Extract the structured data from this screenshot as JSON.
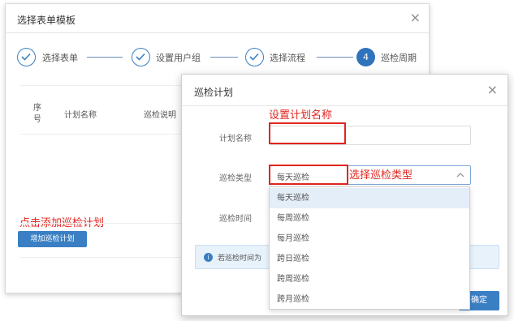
{
  "back_dialog": {
    "title": "选择表单模板",
    "close": "×",
    "steps": [
      {
        "label": "选择表单"
      },
      {
        "label": "设置用户组"
      },
      {
        "label": "选择流程"
      },
      {
        "number": "4",
        "label": "巡检周期"
      }
    ],
    "table_headers": {
      "seq": "序号",
      "name": "计划名称",
      "desc": "巡检说明"
    },
    "add_plan_button": "增加巡检计划"
  },
  "front_dialog": {
    "title": "巡检计划",
    "close": "×",
    "fields": {
      "name_label": "计划名称",
      "type_label": "巡检类型",
      "time_label": "巡检时间",
      "type_value": "每天巡检"
    },
    "info_text": "若巡检时间为",
    "confirm_button": "确定"
  },
  "dropdown_options": [
    "每天巡检",
    "每周巡检",
    "每月巡检",
    "跨日巡检",
    "跨周巡检",
    "跨月巡检"
  ],
  "selected_option": "每天巡检",
  "annotations": {
    "set_name": "设置计划名称",
    "select_type": "选择巡检类型",
    "click_add": "点击添加巡检计划"
  },
  "colors": {
    "accent": "#3a7fc4",
    "annotation": "#e0261f"
  }
}
